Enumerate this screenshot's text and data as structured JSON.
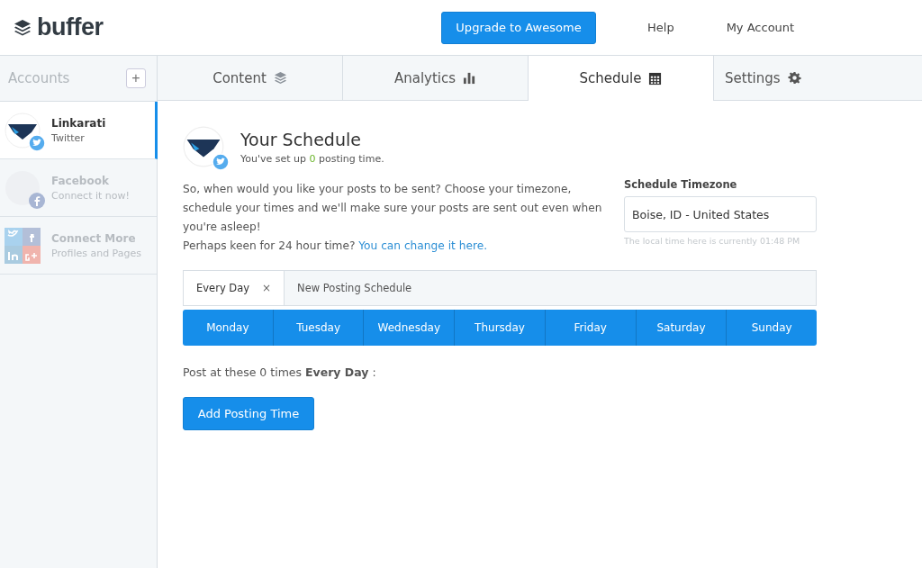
{
  "logo": {
    "text": "buffer"
  },
  "header_links": [
    {
      "label": "Upgrade to Awesome",
      "kind": "primary"
    },
    {
      "label": "Help",
      "kind": "link"
    },
    {
      "label": "My Account",
      "kind": "link"
    }
  ],
  "sidebar": {
    "title": "Accounts",
    "add": "+",
    "accounts": [
      {
        "name": "Linkarati",
        "sub": "Twitter",
        "kind": "twitter",
        "selected": true,
        "connected": true
      },
      {
        "name": "Facebook",
        "sub": "Connect it now!",
        "kind": "facebook",
        "selected": false,
        "connected": false
      },
      {
        "name": "Connect More",
        "sub": "Profiles and Pages",
        "kind": "more",
        "selected": false,
        "connected": false
      }
    ]
  },
  "tabs": [
    {
      "label": "Content",
      "kind": "layers",
      "selected": false
    },
    {
      "label": "Analytics",
      "kind": "bars",
      "selected": false
    },
    {
      "label": "Schedule",
      "kind": "calendar",
      "selected": true
    },
    {
      "label": "Settings",
      "kind": "gear",
      "selected": false
    }
  ],
  "schedule": {
    "title": "Your Schedule",
    "setup": {
      "before": "You've set up ",
      "count": "0",
      "after": " posting time."
    },
    "intro": "So, when would you like your posts to be sent? Choose your timezone, schedule your times and we'll make sure your posts are sent out even when you're asleep!",
    "hint": "Perhaps keen for 24 hour time?",
    "hint_link": "You can change it here.",
    "timezone": {
      "label": "Schedule Timezone",
      "value": "Boise, ID - United States",
      "note": "The local time here is currently 01:48 PM"
    },
    "schedule_tabs": [
      {
        "label": "Every Day",
        "close": "×",
        "selected": true
      },
      {
        "label": "New Posting Schedule",
        "selected": false
      }
    ],
    "days": [
      "Monday",
      "Tuesday",
      "Wednesday",
      "Thursday",
      "Friday",
      "Saturday",
      "Sunday"
    ],
    "summary": "Post at these 0 times **Every Day** :",
    "add_button": "Add Posting Time"
  }
}
